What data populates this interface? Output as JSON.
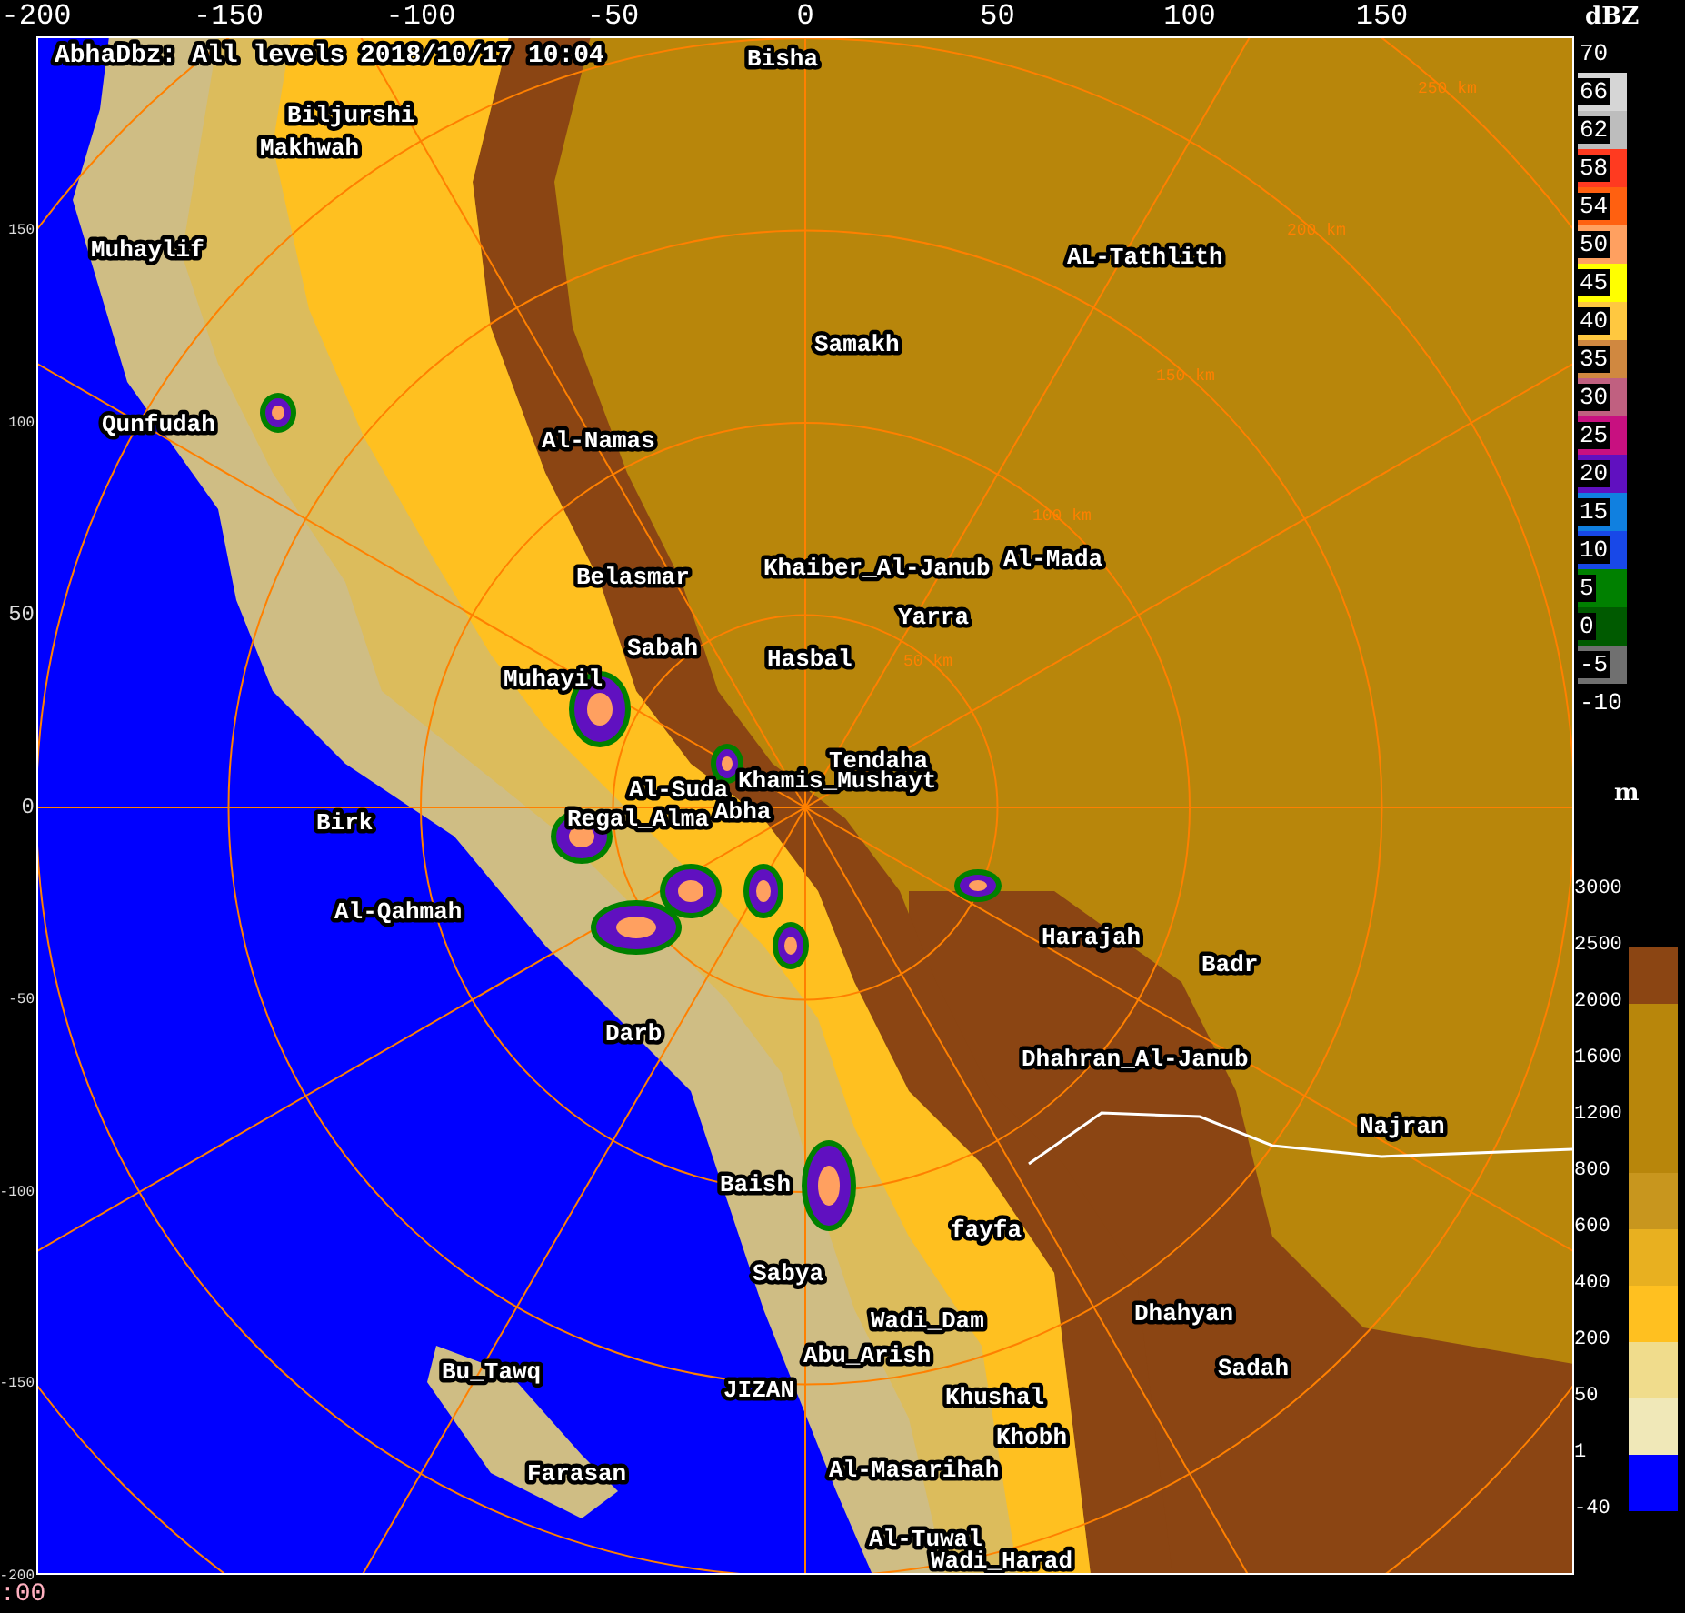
{
  "title": "AbhaDbz: All levels 2018/10/17 10:04",
  "x_ticks": [
    "-200",
    "-150",
    "-100",
    "-50",
    "0",
    "50",
    "100",
    "150"
  ],
  "y_ticks": [
    "150",
    "100",
    "50",
    "0",
    "-50",
    "-100",
    "-150",
    "-200"
  ],
  "places": [
    "Bisha",
    "Biljurshi",
    "Makhwah",
    "Muhaylif",
    "AL-Tathlith",
    "Samakh",
    "Qunfudah",
    "Al-Namas",
    "Al-Mada",
    "Belasmar",
    "Khaiber_Al-Janub",
    "Yarra",
    "Sabah",
    "Hasbal",
    "Muhayil",
    "Tendaha",
    "Al-Suda",
    "Khamis_Mushayt",
    "Regal_Alma",
    "Abha",
    "Birk",
    "Al-Qahmah",
    "Harajah",
    "Badr",
    "Darb",
    "Dhahran_Al-Janub",
    "Najran",
    "Baish",
    "fayfa",
    "Sabya",
    "Dhahyan",
    "Wadi_Dam",
    "Abu_Arish",
    "Bu_Tawq",
    "Sadah",
    "JIZAN",
    "Khushal",
    "Khobh",
    "Farasan",
    "Al-Masarihah",
    "Al-Tuwal",
    "Wadi_Harad"
  ],
  "range_rings": [
    "50 km",
    "100 km",
    "150 km",
    "200 km",
    "250 km"
  ],
  "dbz_legend": {
    "unit": "dBZ",
    "levels": [
      {
        "label": "70",
        "color": "#000000"
      },
      {
        "label": "66",
        "color": "#d6d6d6"
      },
      {
        "label": "62",
        "color": "#bdbdbd"
      },
      {
        "label": "58",
        "color": "#ff3a20"
      },
      {
        "label": "54",
        "color": "#ff6010"
      },
      {
        "label": "50",
        "color": "#ffa060"
      },
      {
        "label": "45",
        "color": "#ffff00"
      },
      {
        "label": "40",
        "color": "#ffc840"
      },
      {
        "label": "35",
        "color": "#d08840"
      },
      {
        "label": "30",
        "color": "#c06080"
      },
      {
        "label": "25",
        "color": "#c81080"
      },
      {
        "label": "20",
        "color": "#6010c0"
      },
      {
        "label": "15",
        "color": "#1080e0"
      },
      {
        "label": "10",
        "color": "#1848e8"
      },
      {
        "label": "5",
        "color": "#008000"
      },
      {
        "label": "0",
        "color": "#005a00"
      },
      {
        "label": "-5",
        "color": "#707070"
      },
      {
        "label": "-10",
        "color": "#000000"
      }
    ]
  },
  "height_legend": {
    "unit": "m",
    "levels": [
      {
        "label": "3000"
      },
      {
        "label": "2500",
        "color": "#8b4513"
      },
      {
        "label": "2000",
        "color": "#b8860b"
      },
      {
        "label": "1600",
        "color": "#b8860b"
      },
      {
        "label": "1200",
        "color": "#b8860b"
      },
      {
        "label": "800",
        "color": "#c8961e"
      },
      {
        "label": "600",
        "color": "#e8b020"
      },
      {
        "label": "400",
        "color": "#ffc020"
      },
      {
        "label": "200",
        "color": "#f0dc8c"
      },
      {
        "label": "50",
        "color": "#f0e8b8"
      },
      {
        "label": "1",
        "color": "#0000ff"
      },
      {
        "label": "-40"
      }
    ]
  },
  "status_text": ":00"
}
